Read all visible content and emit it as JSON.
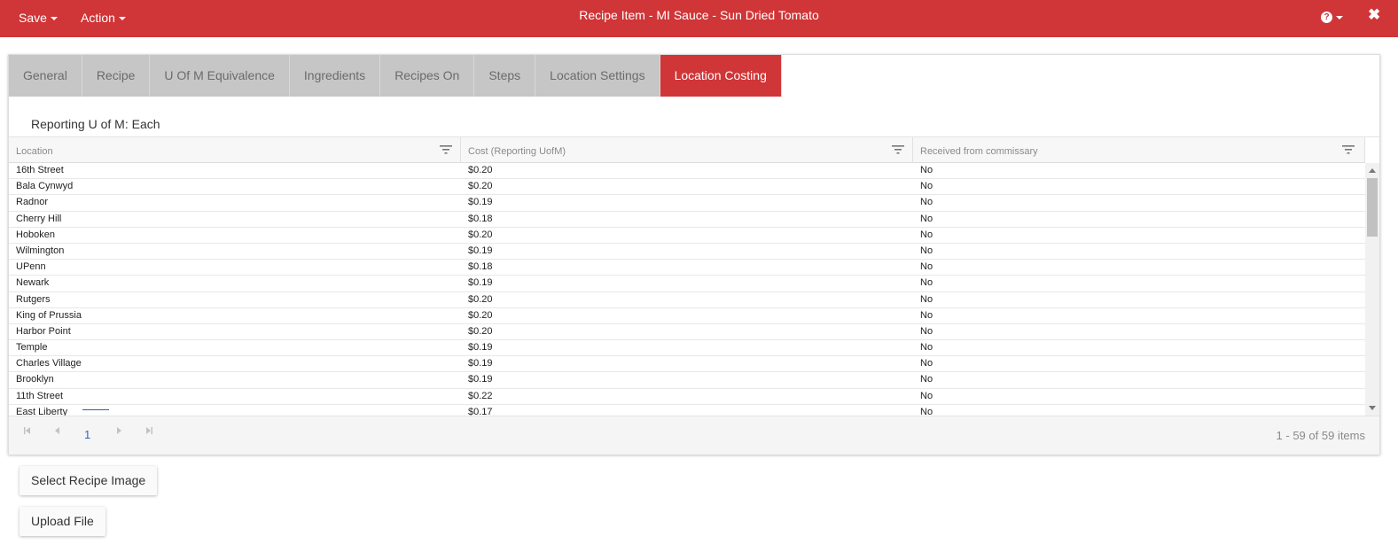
{
  "toolbar": {
    "save_label": "Save",
    "action_label": "Action",
    "title": "Recipe Item - MI Sauce - Sun Dried Tomato"
  },
  "tabs": [
    {
      "label": "General",
      "active": false
    },
    {
      "label": "Recipe",
      "active": false
    },
    {
      "label": "U Of M Equivalence",
      "active": false
    },
    {
      "label": "Ingredients",
      "active": false
    },
    {
      "label": "Recipes On",
      "active": false
    },
    {
      "label": "Steps",
      "active": false
    },
    {
      "label": "Location Settings",
      "active": false
    },
    {
      "label": "Location Costing",
      "active": true
    }
  ],
  "reporting_uom_label": "Reporting U of M: Each",
  "grid": {
    "columns": [
      "Location",
      "Cost (Reporting UofM)",
      "Received from commissary"
    ],
    "rows": [
      [
        "16th Street",
        "$0.20",
        "No"
      ],
      [
        "Bala Cynwyd",
        "$0.20",
        "No"
      ],
      [
        "Radnor",
        "$0.19",
        "No"
      ],
      [
        "Cherry Hill",
        "$0.18",
        "No"
      ],
      [
        "Hoboken",
        "$0.20",
        "No"
      ],
      [
        "Wilmington",
        "$0.19",
        "No"
      ],
      [
        "UPenn",
        "$0.18",
        "No"
      ],
      [
        "Newark",
        "$0.19",
        "No"
      ],
      [
        "Rutgers",
        "$0.20",
        "No"
      ],
      [
        "King of Prussia",
        "$0.20",
        "No"
      ],
      [
        "Harbor Point",
        "$0.20",
        "No"
      ],
      [
        "Temple",
        "$0.19",
        "No"
      ],
      [
        "Charles Village",
        "$0.19",
        "No"
      ],
      [
        "Brooklyn",
        "$0.19",
        "No"
      ],
      [
        "11th Street",
        "$0.22",
        "No"
      ],
      [
        "East Liberty",
        "$0.17",
        "No"
      ]
    ],
    "pager": {
      "current_page": "1",
      "info": "1 - 59 of 59 items"
    }
  },
  "buttons": {
    "select_image": "Select Recipe Image",
    "upload_file": "Upload File"
  },
  "colors": {
    "accent": "#d03537",
    "tab_inactive": "#c6c6c6",
    "link": "#2e6bb5"
  },
  "icons": [
    "caret-down-icon",
    "help-icon",
    "close-icon",
    "filter-icon",
    "first-page-icon",
    "prev-page-icon",
    "next-page-icon",
    "last-page-icon"
  ]
}
